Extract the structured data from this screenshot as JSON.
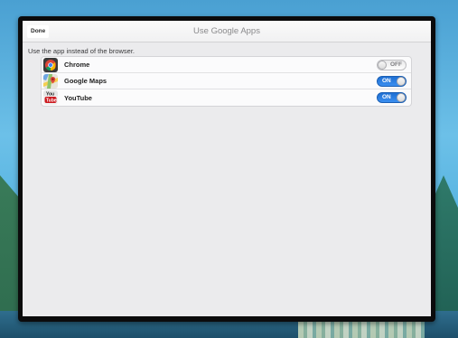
{
  "nav": {
    "done_label": "Done",
    "title": "Use Google Apps"
  },
  "section_label": "Use the app instead of the browser.",
  "apps": [
    {
      "name": "Chrome",
      "icon": "chrome-icon",
      "state": "OFF",
      "enabled": false
    },
    {
      "name": "Google Maps",
      "icon": "google-maps-icon",
      "state": "ON",
      "enabled": true
    },
    {
      "name": "YouTube",
      "icon": "youtube-icon",
      "state": "ON",
      "enabled": true
    }
  ],
  "colors": {
    "toggle_on": "#2d7fe6",
    "toggle_off": "#f4f4f5",
    "screen_bg": "#ebebed"
  }
}
